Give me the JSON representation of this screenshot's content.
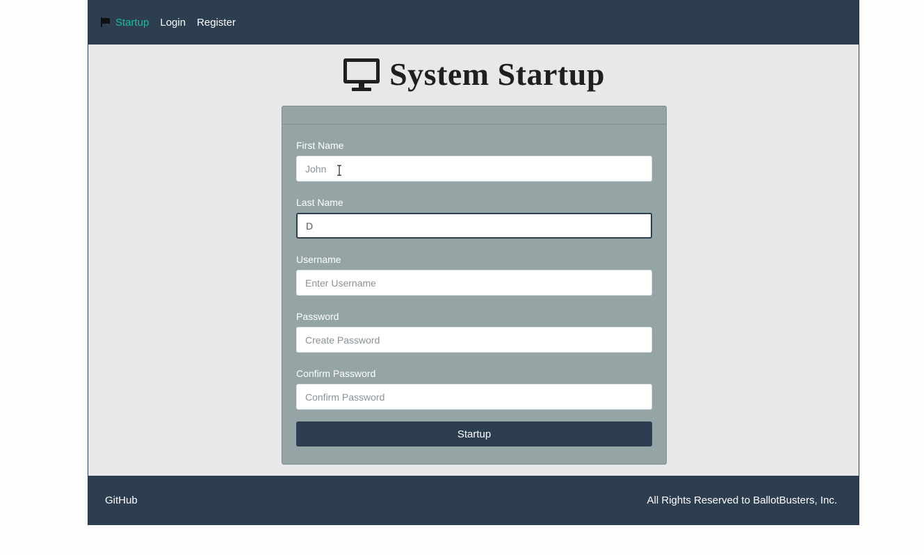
{
  "navbar": {
    "items": [
      {
        "label": "Startup",
        "icon": "flag-icon",
        "active": true
      },
      {
        "label": "Login"
      },
      {
        "label": "Register"
      }
    ],
    "colors": {
      "background": "#2c3e50",
      "active": "#1abc9c"
    }
  },
  "page": {
    "title": "System Startup",
    "icon": "monitor-icon"
  },
  "form": {
    "fields": [
      {
        "label": "First Name",
        "value": "",
        "placeholder": "John"
      },
      {
        "label": "Last Name",
        "value": "D",
        "placeholder": ""
      },
      {
        "label": "Username",
        "value": "",
        "placeholder": "Enter Username"
      },
      {
        "label": "Password",
        "value": "",
        "placeholder": "Create Password"
      },
      {
        "label": "Confirm Password",
        "value": "",
        "placeholder": "Confirm Password"
      }
    ],
    "submit_label": "Startup"
  },
  "footer": {
    "link": "GitHub",
    "copyright": "All Rights Reserved to BallotBusters, Inc."
  }
}
